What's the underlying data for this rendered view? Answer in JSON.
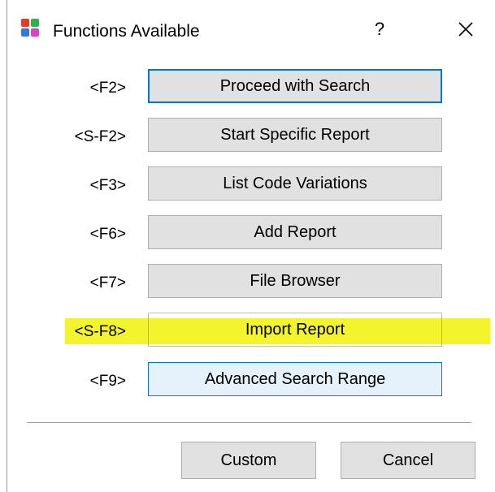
{
  "window": {
    "title": "Functions Available",
    "help_label": "?",
    "close_icon": "close-icon",
    "app_icon": "colored-squares-icon"
  },
  "functions": [
    {
      "key": "<F2>",
      "label": "Proceed with Search",
      "state": "focused"
    },
    {
      "key": "<S-F2>",
      "label": "Start Specific Report",
      "state": "normal"
    },
    {
      "key": "<F3>",
      "label": "List Code Variations",
      "state": "normal"
    },
    {
      "key": "<F6>",
      "label": "Add Report",
      "state": "normal"
    },
    {
      "key": "<F7>",
      "label": "File Browser",
      "state": "normal"
    },
    {
      "key": "<S-F8>",
      "label": "Import Report",
      "state": "highlighted"
    },
    {
      "key": "<F9>",
      "label": "Advanced Search Range",
      "state": "hovered"
    }
  ],
  "footer": {
    "custom_label": "Custom",
    "cancel_label": "Cancel"
  },
  "colors": {
    "highlight": "#f0f000",
    "focus_border": "#0078d7",
    "button_face": "#e1e1e1",
    "hover_face": "#e5f1fb"
  }
}
